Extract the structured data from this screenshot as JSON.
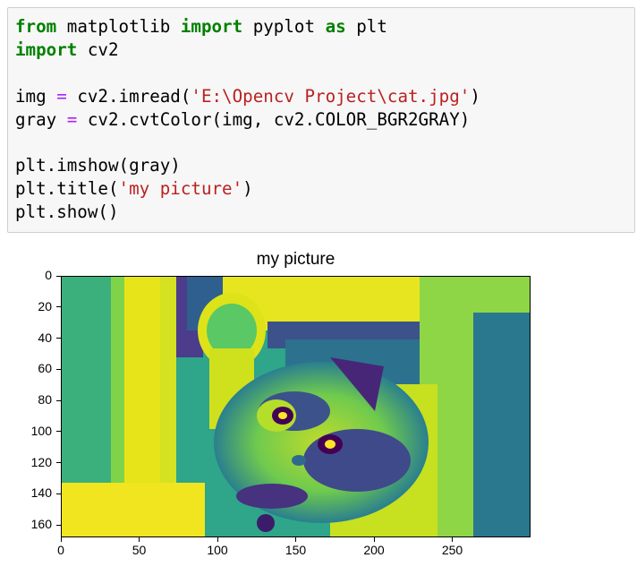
{
  "code_cell": {
    "lines": [
      [
        {
          "t": "from",
          "c": "kw"
        },
        {
          "t": " matplotlib ",
          "c": ""
        },
        {
          "t": "import",
          "c": "kw"
        },
        {
          "t": " pyplot ",
          "c": ""
        },
        {
          "t": "as",
          "c": "kw"
        },
        {
          "t": " plt",
          "c": ""
        }
      ],
      [
        {
          "t": "import",
          "c": "kw"
        },
        {
          "t": " cv2",
          "c": ""
        }
      ],
      [],
      [
        {
          "t": "img ",
          "c": ""
        },
        {
          "t": "=",
          "c": "op"
        },
        {
          "t": " cv2.imread(",
          "c": ""
        },
        {
          "t": "'E:\\Opencv Project\\cat.jpg'",
          "c": "str"
        },
        {
          "t": ")",
          "c": ""
        }
      ],
      [
        {
          "t": "gray ",
          "c": ""
        },
        {
          "t": "=",
          "c": "op"
        },
        {
          "t": " cv2.cvtColor(img, cv2.COLOR_BGR2GRAY)",
          "c": ""
        }
      ],
      [],
      [
        {
          "t": "plt.imshow(gray)",
          "c": ""
        }
      ],
      [
        {
          "t": "plt.title(",
          "c": ""
        },
        {
          "t": "'my picture'",
          "c": "str"
        },
        {
          "t": ")",
          "c": ""
        }
      ],
      [
        {
          "t": "plt.show()",
          "c": ""
        }
      ]
    ]
  },
  "output": {
    "plot_title": "my picture",
    "y_ticks": [
      "0",
      "20",
      "40",
      "60",
      "80",
      "100",
      "120",
      "140",
      "160"
    ],
    "x_ticks": [
      "0",
      "50",
      "100",
      "150",
      "200",
      "250"
    ],
    "y_range": [
      0,
      168
    ],
    "x_range": [
      0,
      300
    ],
    "colormap": "viridis",
    "colors": {
      "dark": "#440154",
      "mid": "#21918c",
      "light": "#fde725"
    }
  }
}
